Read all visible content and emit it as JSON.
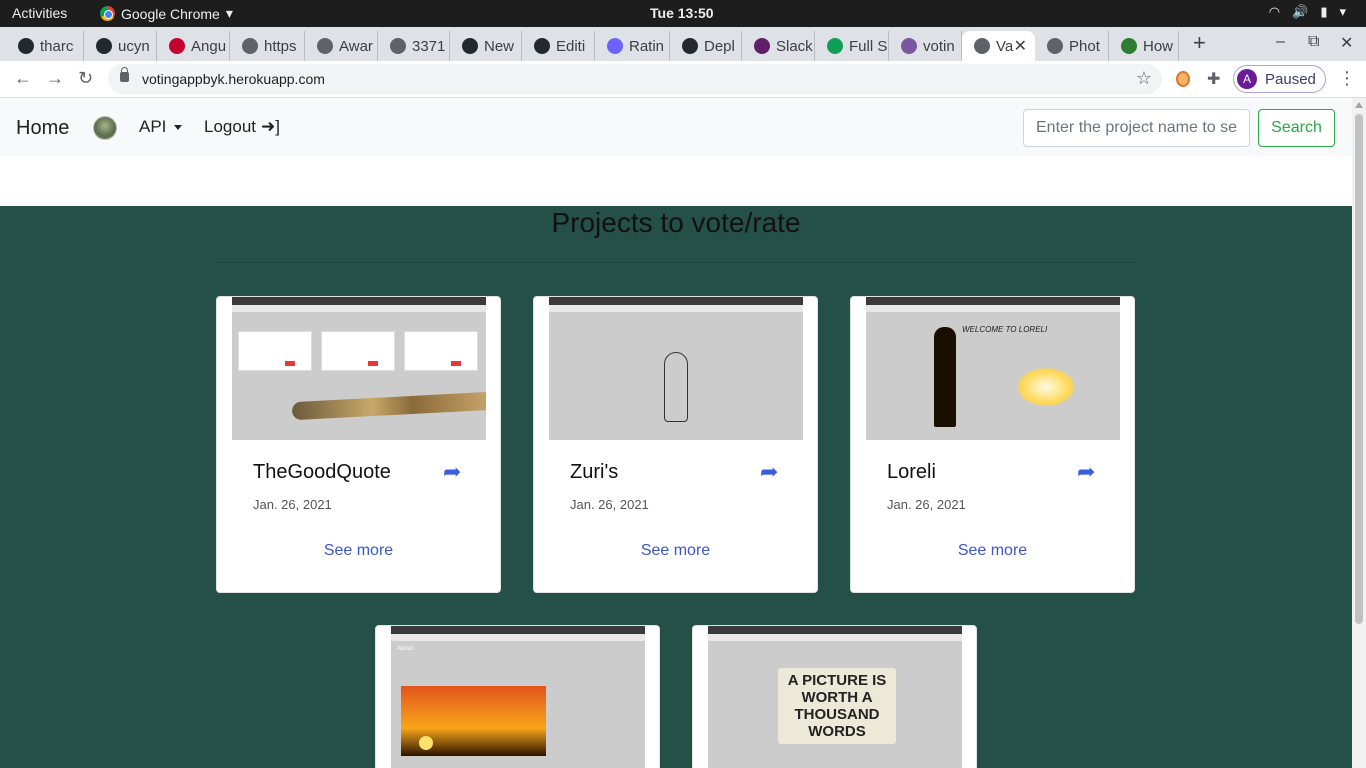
{
  "system": {
    "activities_label": "Activities",
    "app_name": "Google Chrome",
    "clock": "Tue 13:50"
  },
  "tabs": [
    {
      "label": "tharc",
      "icon": "github-icon",
      "active": false
    },
    {
      "label": "ucyn",
      "icon": "github-icon",
      "active": false
    },
    {
      "label": "Angu",
      "icon": "angular-icon",
      "active": false
    },
    {
      "label": "https",
      "icon": "globe-icon",
      "active": false
    },
    {
      "label": "Awar",
      "icon": "globe-icon",
      "active": false
    },
    {
      "label": "3371",
      "icon": "globe-icon",
      "active": false
    },
    {
      "label": "New",
      "icon": "github-icon",
      "active": false
    },
    {
      "label": "Editi",
      "icon": "github-icon",
      "active": false
    },
    {
      "label": "Ratin",
      "icon": "bars-icon",
      "active": false
    },
    {
      "label": "Depl",
      "icon": "github-icon",
      "active": false
    },
    {
      "label": "Slack",
      "icon": "slack-icon",
      "active": false
    },
    {
      "label": "Full S",
      "icon": "drive-icon",
      "active": false
    },
    {
      "label": "votin",
      "icon": "heroku-icon",
      "active": false
    },
    {
      "label": "Va",
      "icon": "globe-icon",
      "active": true
    },
    {
      "label": "Phot",
      "icon": "globe-icon",
      "active": false
    },
    {
      "label": "How",
      "icon": "leaf-icon",
      "active": false
    }
  ],
  "toolbar": {
    "url": "votingappbyk.herokuapp.com",
    "profile_initial": "A",
    "profile_status": "Paused"
  },
  "navbar": {
    "home": "Home",
    "api": "API",
    "logout": "Logout",
    "search_placeholder": "Enter the project name to search",
    "search_button": "Search"
  },
  "section_title": "Projects to vote/rate",
  "projects": [
    {
      "title": "TheGoodQuote",
      "date": "Jan. 26, 2021",
      "link": "See more"
    },
    {
      "title": "Zuri's",
      "date": "Jan. 26, 2021",
      "link": "See more"
    },
    {
      "title": "Loreli",
      "date": "Jan. 26, 2021",
      "link": "See more"
    },
    {
      "title": "",
      "date": "",
      "link": ""
    },
    {
      "title": "",
      "date": "",
      "link": ""
    }
  ],
  "thumb_texts": {
    "loreli_welcome": "WELCOME TO LORELI",
    "about_title": "About",
    "picture_sign": "A PICTURE IS WORTH A THOUSAND WORDS"
  },
  "colors": {
    "teal_bg": "#255048",
    "link_blue": "#3d56c9",
    "search_green": "#28a745",
    "share_blue": "#3d5de0"
  }
}
